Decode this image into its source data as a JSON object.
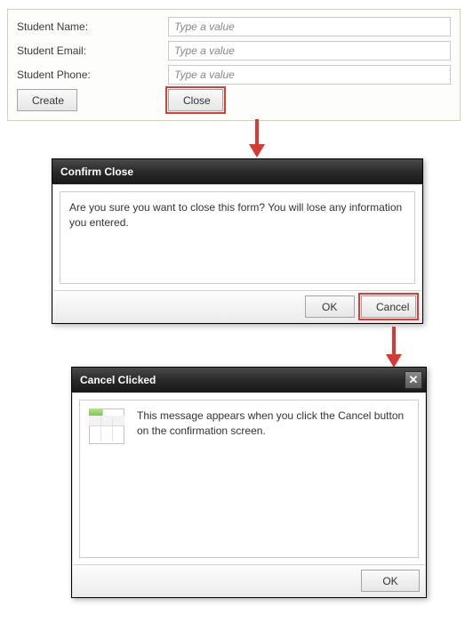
{
  "form": {
    "fields": [
      {
        "label": "Student Name:",
        "placeholder": "Type a value"
      },
      {
        "label": "Student Email:",
        "placeholder": "Type a value"
      },
      {
        "label": "Student Phone:",
        "placeholder": "Type a value"
      }
    ],
    "create_label": "Create",
    "close_label": "Close"
  },
  "confirm": {
    "title": "Confirm Close",
    "message": "Are you sure you want to close this form? You will lose any information you entered.",
    "ok_label": "OK",
    "cancel_label": "Cancel"
  },
  "result": {
    "title": "Cancel Clicked",
    "message": "This message appears when you click the Cancel button on the confirmation screen.",
    "ok_label": "OK",
    "close_x": "✕"
  }
}
